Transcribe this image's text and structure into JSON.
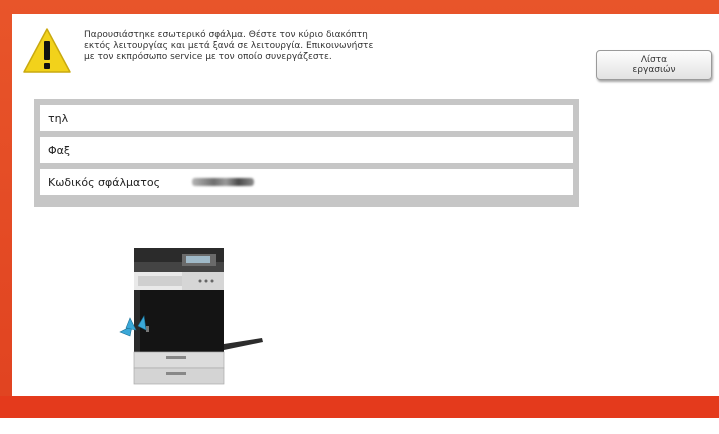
{
  "error_screen": {
    "message_lines": [
      "Παρουσιάστηκε εσωτερικό σφάλμα. Θέστε τον κύριο διακόπτη",
      "εκτός λειτουργίας και μετά ξανά σε λειτουργία. Επικοινωνήστε",
      "με τον εκπρόσωπο service με τον οποίο συνεργάζεστε."
    ],
    "job_list_button": {
      "line1": "Λίστα",
      "line2": "εργασιών"
    },
    "info_rows": [
      {
        "label": "τηλ",
        "value": ""
      },
      {
        "label": "Φαξ",
        "value": ""
      },
      {
        "label": "Κωδικός σφάλματος",
        "value": ""
      }
    ]
  },
  "colors": {
    "frame": "#e04220",
    "bottom_band": "#e43a1c",
    "warning_yellow": "#f2d21b",
    "table_border": "#c6c6c6"
  },
  "icons": {
    "warning": "warning-triangle-icon",
    "machine": "printer-machine-illustration"
  }
}
